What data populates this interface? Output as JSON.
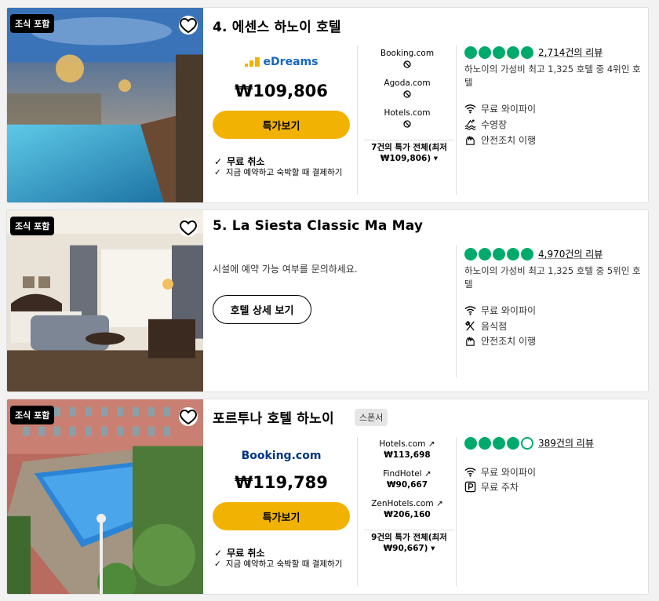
{
  "hotels": [
    {
      "badge": "조식 포함",
      "title": "4. 에센스 하노이 호텔",
      "provider_logo": "eDreams",
      "price": "₩109,806",
      "deal_button": "특가보기",
      "cancel": "무료 취소",
      "pay_later": "지금 예약하고 숙박할 때 결제하기",
      "providers": [
        {
          "name": "Booking.com",
          "icon": "unavailable-icon"
        },
        {
          "name": "Agoda.com",
          "icon": "unavailable-icon"
        },
        {
          "name": "Hotels.com",
          "icon": "unavailable-icon"
        }
      ],
      "all_deals": "7건의 특가 전체(최저",
      "all_deals_price": "₩109,806)",
      "rating": 5,
      "reviews": "2,714건의 리뷰",
      "rank": "하노이의 가성비 최고 1,325 호텔 중 4위인 호텔",
      "amenities": [
        {
          "icon": "wifi-icon",
          "label": "무료 와이파이"
        },
        {
          "icon": "pool-icon",
          "label": "수영장"
        },
        {
          "icon": "hand-sanitizer-icon",
          "label": "안전조치 이행"
        }
      ]
    },
    {
      "badge": "조식 포함",
      "title": "5. La Siesta Classic Ma May",
      "inquiry": "시설에 예약 가능 여부를 문의하세요.",
      "detail_button": "호텔 상세 보기",
      "rating": 5,
      "reviews": "4,970건의 리뷰",
      "rank": "하노이의 가성비 최고 1,325 호텔 중 5위인 호텔",
      "amenities": [
        {
          "icon": "wifi-icon",
          "label": "무료 와이파이"
        },
        {
          "icon": "restaurant-icon",
          "label": "음식점"
        },
        {
          "icon": "hand-sanitizer-icon",
          "label": "안전조치 이행"
        }
      ]
    },
    {
      "badge": "조식 포함",
      "title": "포르투나 호텔 하노이",
      "sponsor": "스폰서",
      "provider_logo": "Booking.com",
      "price": "₩119,789",
      "deal_button": "특가보기",
      "cancel": "무료 취소",
      "pay_later": "지금 예약하고 숙박할 때 결제하기",
      "providers": [
        {
          "name": "Hotels.com",
          "price": "₩113,698"
        },
        {
          "name": "FindHotel",
          "price": "₩90,667"
        },
        {
          "name": "ZenHotels.com",
          "price": "₩206,160"
        }
      ],
      "all_deals": "9건의 특가 전체(최저",
      "all_deals_price": "₩90,667)",
      "rating": 4,
      "reviews": "389건의 리뷰",
      "amenities": [
        {
          "icon": "wifi-icon",
          "label": "무료 와이파이"
        },
        {
          "icon": "parking-icon",
          "label": "무료 주차"
        }
      ]
    }
  ],
  "colors": {
    "rating": "#00aa6c",
    "deal_button": "#f2b203",
    "edreams_blue": "#1565c0",
    "booking_blue": "#003580"
  }
}
